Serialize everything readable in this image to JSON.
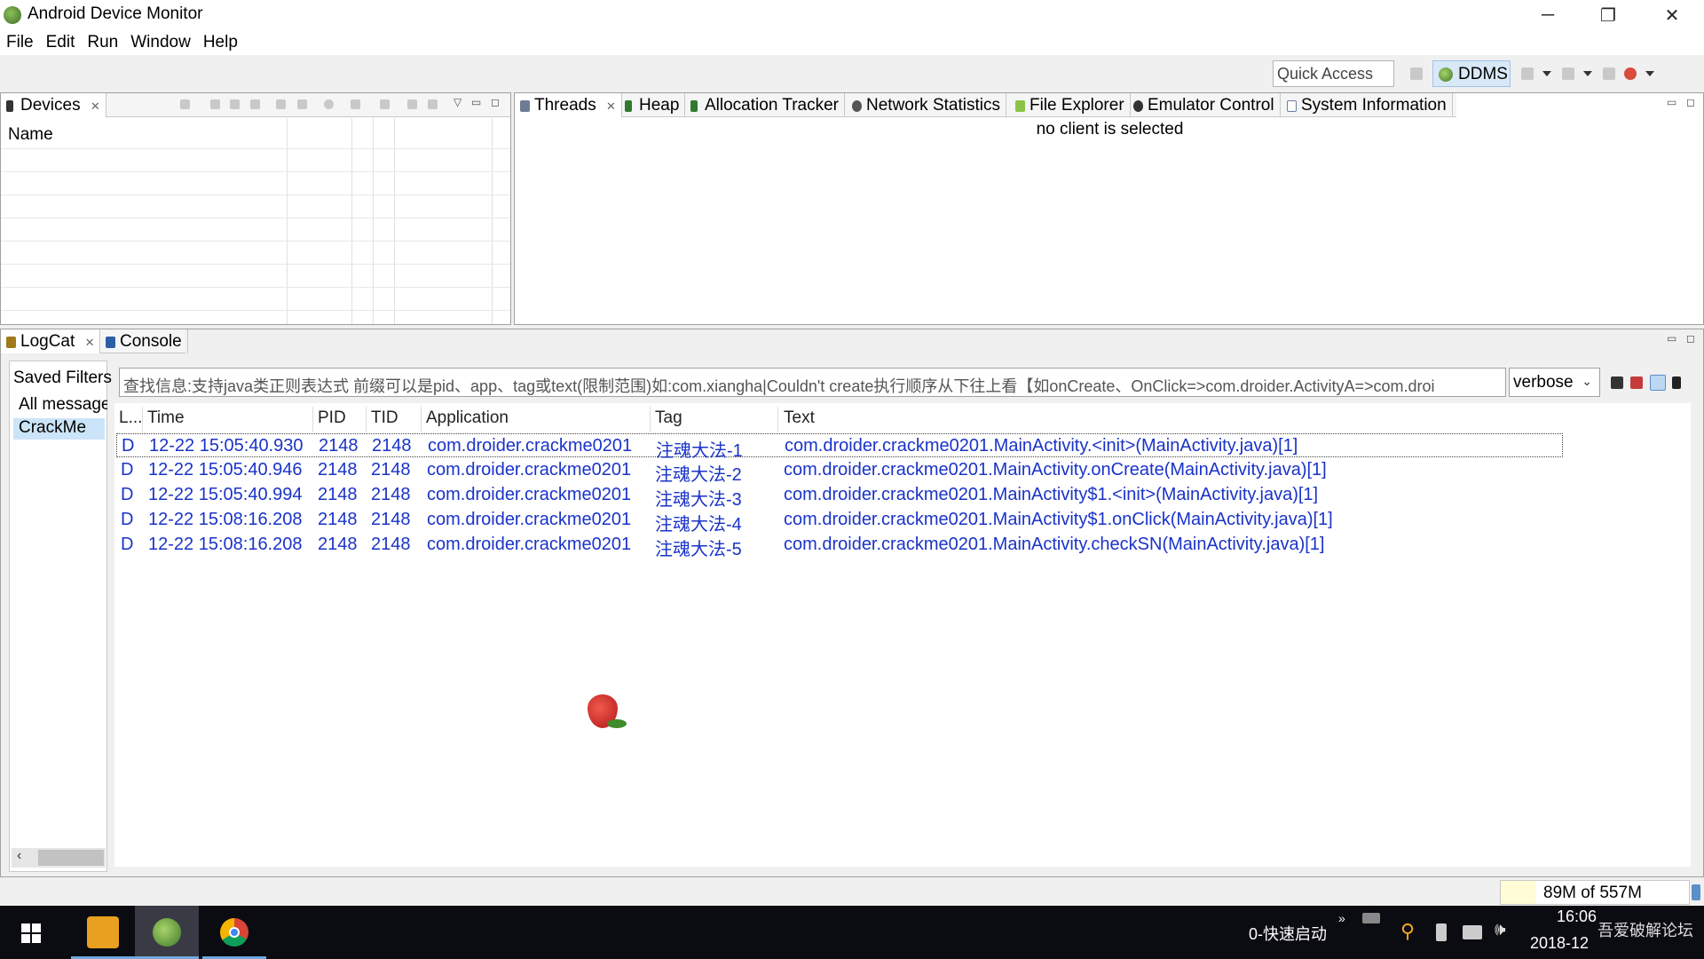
{
  "window": {
    "title": "Android Device Monitor",
    "minimize": "─",
    "restore": "❐",
    "close": "✕"
  },
  "menu": [
    "File",
    "Edit",
    "Run",
    "Window",
    "Help"
  ],
  "toolbar": {
    "quick_access_placeholder": "Quick Access",
    "perspective": "DDMS"
  },
  "devices_panel": {
    "tab_label": "Devices",
    "column_name": "Name"
  },
  "client_panel": {
    "tabs": [
      "Threads",
      "Heap",
      "Allocation Tracker",
      "Network Statistics",
      "File Explorer",
      "Emulator Control",
      "System Information"
    ],
    "message": "no client is selected"
  },
  "log_panel": {
    "tabs": [
      "LogCat",
      "Console"
    ],
    "saved_filters_label": "Saved Filters",
    "filters": [
      "All messages",
      "CrackMe"
    ],
    "search_text": "查找信息:支持java类正则表达式 前缀可以是pid、app、tag或text(限制范围)如:com.xiangha|Couldn't create执行顺序从下往上看【如onCreate、OnClick=>com.droider.ActivityA=>com.droi",
    "level": "verbose",
    "columns": [
      "L...",
      "Time",
      "PID",
      "TID",
      "Application",
      "Tag",
      "Text"
    ],
    "rows": [
      {
        "level": "D",
        "time": "12-22 15:05:40.930",
        "pid": "2148",
        "tid": "2148",
        "app": "com.droider.crackme0201",
        "tag": "注魂大法-1",
        "text": "com.droider.crackme0201.MainActivity.<init>(MainActivity.java)[1]"
      },
      {
        "level": "D",
        "time": "12-22 15:05:40.946",
        "pid": "2148",
        "tid": "2148",
        "app": "com.droider.crackme0201",
        "tag": "注魂大法-2",
        "text": "com.droider.crackme0201.MainActivity.onCreate(MainActivity.java)[1]"
      },
      {
        "level": "D",
        "time": "12-22 15:05:40.994",
        "pid": "2148",
        "tid": "2148",
        "app": "com.droider.crackme0201",
        "tag": "注魂大法-3",
        "text": "com.droider.crackme0201.MainActivity$1.<init>(MainActivity.java)[1]"
      },
      {
        "level": "D",
        "time": "12-22 15:08:16.208",
        "pid": "2148",
        "tid": "2148",
        "app": "com.droider.crackme0201",
        "tag": "注魂大法-4",
        "text": "com.droider.crackme0201.MainActivity$1.onClick(MainActivity.java)[1]"
      },
      {
        "level": "D",
        "time": "12-22 15:08:16.208",
        "pid": "2148",
        "tid": "2148",
        "app": "com.droider.crackme0201",
        "tag": "注魂大法-5",
        "text": "com.droider.crackme0201.MainActivity.checkSN(MainActivity.java)[1]"
      }
    ]
  },
  "status": {
    "memory": "89M of 557M"
  },
  "taskbar": {
    "quick_start": "0-快速启动",
    "clock_time": "16:06",
    "clock_date": "2018-12",
    "watermark": "吾爱破解论坛"
  },
  "colors": {
    "log_text": "#1a33c8",
    "ddms_bg": "#d9e8f7"
  }
}
